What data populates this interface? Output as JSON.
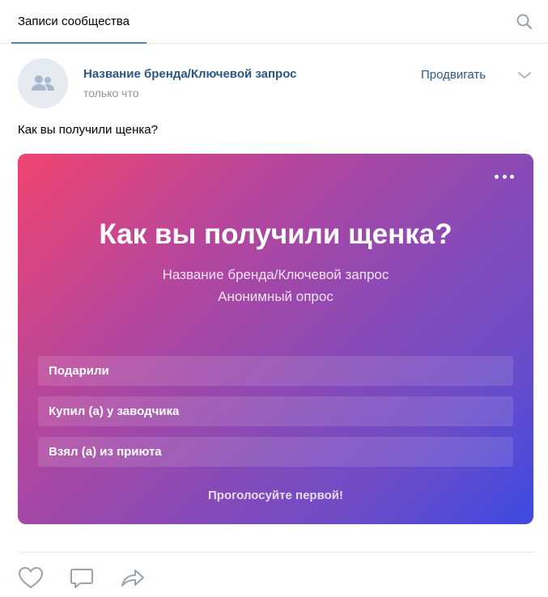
{
  "tabs": {
    "active_label": "Записи сообщества"
  },
  "post": {
    "author": "Название бренда/Ключевой запрос",
    "time": "только что",
    "promote_label": "Продвигать",
    "text": "Как вы получили щенка?"
  },
  "poll": {
    "question": "Как вы получили щенка?",
    "subtitle_author": "Название бренда/Ключевой запрос",
    "subtitle_type": "Анонимный опрос",
    "options": [
      {
        "label": "Подарили"
      },
      {
        "label": "Купил (а) у заводчика"
      },
      {
        "label": "Взял (а) из приюта"
      }
    ],
    "footer": "Проголосуйте первой!",
    "gradient_colors": [
      "#f0456f",
      "#8f4ab3",
      "#3c4ae2"
    ]
  },
  "icons": {
    "search": "search-icon",
    "avatar": "community-icon",
    "chevron": "chevron-down-icon",
    "more": "more-icon",
    "like": "heart-icon",
    "comment": "comment-icon",
    "share": "share-icon"
  },
  "colors": {
    "link": "#2a5885",
    "accent": "#5181b8",
    "muted": "#939393"
  }
}
